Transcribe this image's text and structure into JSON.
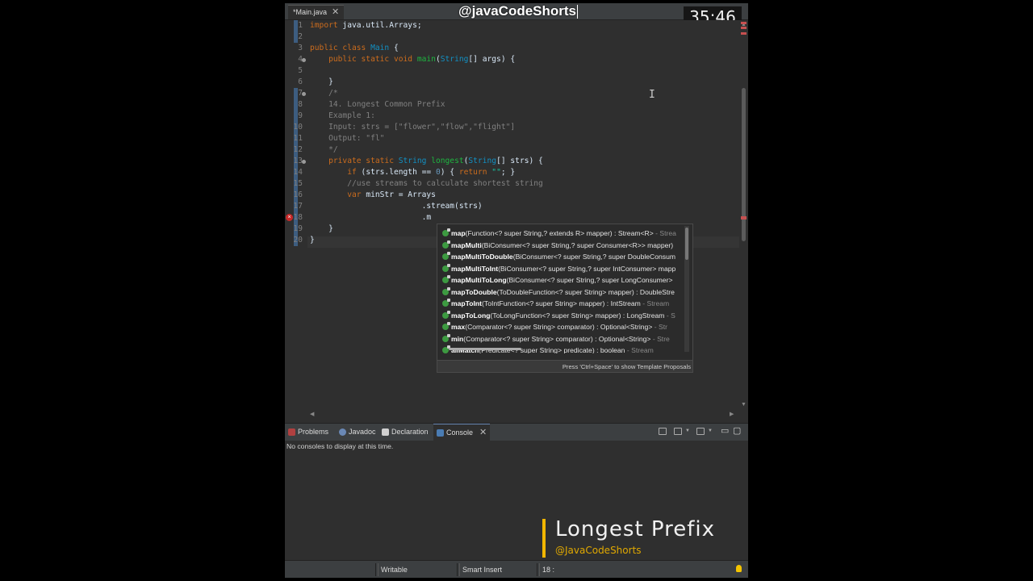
{
  "overlay": {
    "handle": "@javaCodeShorts",
    "timer": "35:46",
    "title_word1": "Longest",
    "title_word2": "Prefix",
    "subtitle": "@JavaCodeShorts"
  },
  "editor": {
    "tab_label": "*Main.java",
    "tab_close": "✕",
    "line_numbers": [
      "1",
      "2",
      "3",
      "4",
      "5",
      "6",
      "7",
      "8",
      "9",
      "10",
      "11",
      "12",
      "13",
      "14",
      "15",
      "16",
      "17",
      "18",
      "19",
      "20"
    ]
  },
  "code": {
    "l1_kw": "import",
    "l1_rest": " java.util.Arrays;",
    "l3_kw": "public class",
    "l3_ty": "Main",
    "l3_rest": " {",
    "l4_kw": "    public static void",
    "l4_fn": "main",
    "l4_a": "(",
    "l4_ty": "String",
    "l4_b": "[] args) {",
    "l6": "    }",
    "l7": "    /*",
    "l8": "    14. Longest Common Prefix",
    "l9": "    Example 1:",
    "l10": "    Input: strs = [\"flower\",\"flow\",\"flight\"]",
    "l11": "    Output: \"fl\"",
    "l12": "    */",
    "l13_kw": "    private static",
    "l13_ty": "String",
    "l13_fn": "longest",
    "l13_a": "(",
    "l13_ty2": "String",
    "l13_b": "[] strs) {",
    "l14_kw": "        if",
    "l14_a": " (strs.length == ",
    "l14_nm": "0",
    "l14_b": ") { ",
    "l14_kw2": "return",
    "l14_st": " \"\"",
    "l14_c": "; }",
    "l15": "        //use streams to calculate shortest string",
    "l16_kw": "        var",
    "l16_rest": " minStr = Arrays",
    "l17": "                        .stream(strs)",
    "l18": "                        .m",
    "l19": "    }",
    "l20": "}"
  },
  "assist": {
    "proposals": [
      {
        "name": "map",
        "sig": "(Function<? super String,? extends R> mapper) : Stream<R>",
        "decl": " - Strea"
      },
      {
        "name": "mapMulti",
        "sig": "(BiConsumer<? super String,? super Consumer<R>> mapper)",
        "decl": ""
      },
      {
        "name": "mapMultiToDouble",
        "sig": "(BiConsumer<? super String,? super DoubleConsum",
        "decl": ""
      },
      {
        "name": "mapMultiToInt",
        "sig": "(BiConsumer<? super String,? super IntConsumer> mapp",
        "decl": ""
      },
      {
        "name": "mapMultiToLong",
        "sig": "(BiConsumer<? super String,? super LongConsumer>",
        "decl": ""
      },
      {
        "name": "mapToDouble",
        "sig": "(ToDoubleFunction<? super String> mapper) : DoubleStre",
        "decl": ""
      },
      {
        "name": "mapToInt",
        "sig": "(ToIntFunction<? super String> mapper) : IntStream",
        "decl": " - Stream"
      },
      {
        "name": "mapToLong",
        "sig": "(ToLongFunction<? super String> mapper) : LongStream",
        "decl": " - S"
      },
      {
        "name": "max",
        "sig": "(Comparator<? super String> comparator) : Optional<String>",
        "decl": " - Str"
      },
      {
        "name": "min",
        "sig": "(Comparator<? super String> comparator) : Optional<String>",
        "decl": " - Stre"
      },
      {
        "name": "allMatch",
        "sig": "(Predicate<? super String> predicate) : boolean",
        "decl": " - Stream"
      }
    ],
    "footer": "Press 'Ctrl+Space' to show Template Proposals"
  },
  "views": {
    "tabs": [
      "Problems",
      "Javadoc",
      "Declaration",
      "Console"
    ],
    "console_close": "✕",
    "console_message": "No consoles to display at this time."
  },
  "statusbar": {
    "writable": "Writable",
    "insert_mode": "Smart Insert",
    "position": "18 : "
  },
  "colors": {
    "keyword": "#cc6c1d",
    "type": "#1290c3",
    "method": "#1eb540",
    "comment": "#808080",
    "accent_bar": "#f2b600"
  }
}
